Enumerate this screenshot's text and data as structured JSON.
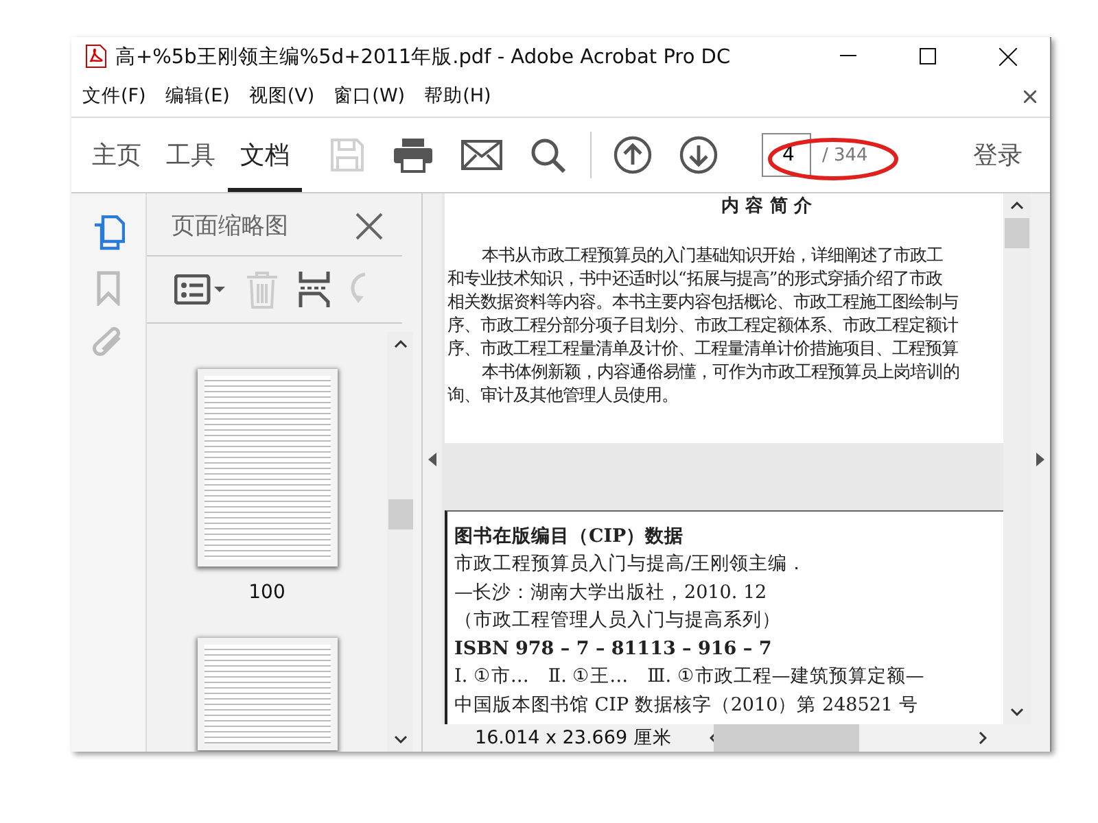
{
  "window": {
    "title": "高+%5b王刚领主编%5d+2011年版.pdf - Adobe Acrobat Pro DC"
  },
  "menu": [
    {
      "label": "文件(F)"
    },
    {
      "label": "编辑(E)"
    },
    {
      "label": "视图(V)"
    },
    {
      "label": "窗口(W)"
    },
    {
      "label": "帮助(H)"
    }
  ],
  "tabs": [
    {
      "label": "主页",
      "selected": false
    },
    {
      "label": "工具",
      "selected": false
    },
    {
      "label": "文档",
      "selected": true
    }
  ],
  "tools": [
    {
      "kind": "save",
      "disabled": true
    },
    {
      "kind": "print",
      "disabled": false
    },
    {
      "kind": "mail",
      "disabled": false
    },
    {
      "kind": "search",
      "disabled": false
    },
    {
      "kind": "up",
      "disabled": false
    },
    {
      "kind": "down",
      "disabled": false
    }
  ],
  "page_nav": {
    "current": "4",
    "total": "/ 344",
    "annotated": true
  },
  "sign_in": "登录",
  "rail": [
    {
      "kind": "pages",
      "selected": true
    },
    {
      "kind": "bookmarks",
      "selected": false
    },
    {
      "kind": "attachments",
      "selected": false
    }
  ],
  "thumbnails_panel": {
    "title": "页面缩略图",
    "tools": [
      {
        "kind": "options",
        "disabled": false
      },
      {
        "kind": "delete",
        "disabled": true
      },
      {
        "kind": "insert",
        "disabled": false
      },
      {
        "kind": "rotate",
        "disabled": true
      }
    ],
    "thumbnail_labels": [
      "100"
    ]
  },
  "document": {
    "heading": "内 容 简 介",
    "lines": [
      {
        "text": "本书从市政工程预算员的入门基础知识开始，详细阐述了市政工",
        "indent": true
      },
      {
        "text": "和专业技术知识，书中还适时以“拓展与提高”的形式穿插介绍了市政",
        "indent": false
      },
      {
        "text": "相关数据资料等内容。本书主要内容包括概论、市政工程施工图绘制与",
        "indent": false
      },
      {
        "text": "序、市政工程分部分项子目划分、市政工程定额体系、市政工程定额计",
        "indent": false
      },
      {
        "text": "序、市政工程工程量清单及计价、工程量清单计价措施项目、工程预算",
        "indent": false
      },
      {
        "text": "本书体例新颖，内容通俗易懂，可作为市政工程预算员上岗培训的",
        "indent": true
      },
      {
        "text": "询、审计及其他管理人员使用。",
        "indent": false
      }
    ],
    "cip_lines": [
      {
        "text": "图书在版编目（CIP）数据",
        "bold": true
      },
      {
        "text": "市政工程预算员入门与提高/王刚领主编．",
        "bold": false
      },
      {
        "text": "—长沙：湖南大学出版社，2010. 12",
        "bold": false
      },
      {
        "text": "（市政工程管理人员入门与提高系列）",
        "bold": false
      },
      {
        "text": "ISBN 978 – 7 – 81113 – 916 – 7",
        "bold": true
      },
      {
        "text": "Ⅰ. ①市…　Ⅱ. ①王…　Ⅲ. ①市政工程—建筑预算定额—",
        "bold": false
      },
      {
        "text": "中国版本图书馆 CIP 数据核字（2010）第 248521 号",
        "bold": false
      }
    ]
  },
  "status_bar": {
    "page_size": "16.014 x 23.669 厘米"
  }
}
